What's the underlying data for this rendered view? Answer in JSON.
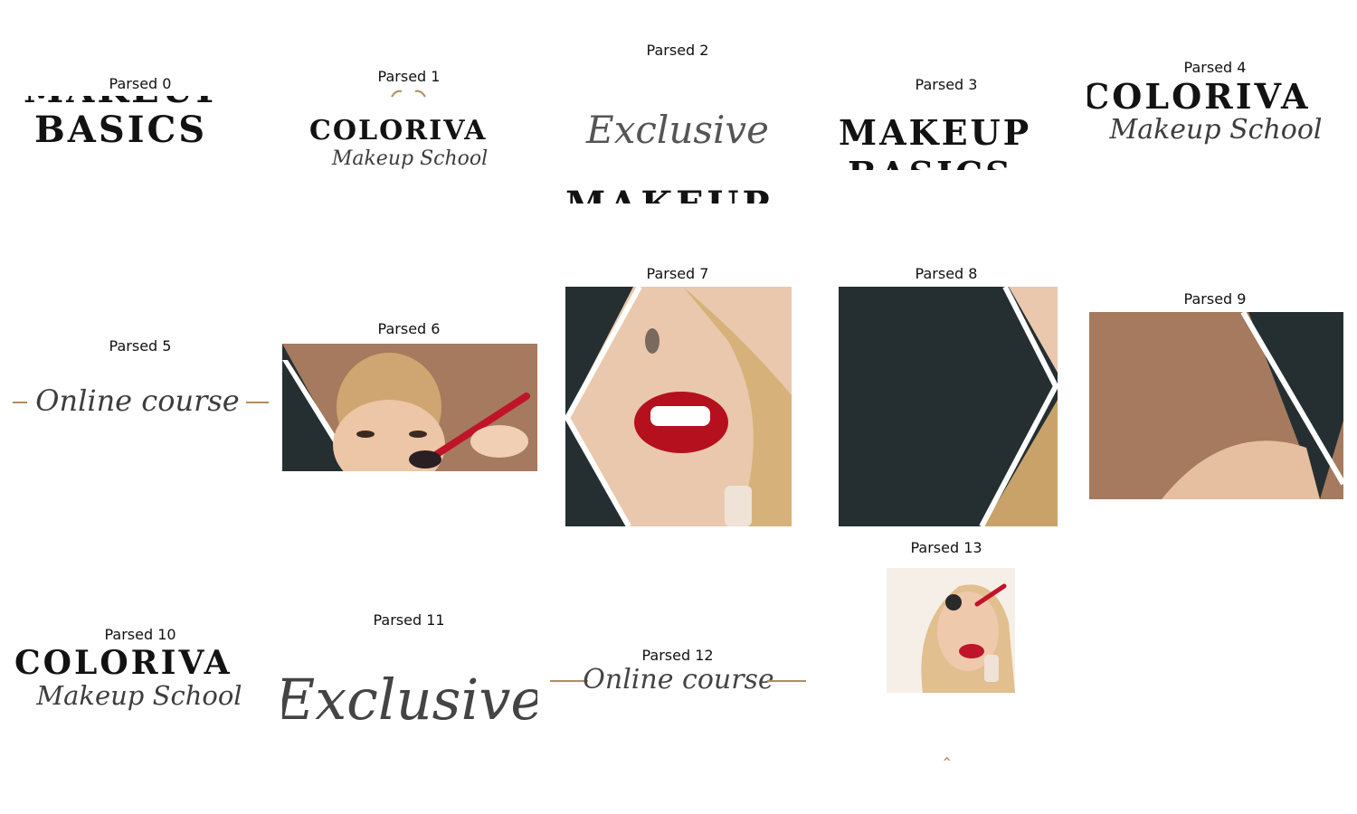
{
  "captions": [
    "Parsed 0",
    "Parsed 1",
    "Parsed 2",
    "Parsed 3",
    "Parsed 4",
    "Parsed 5",
    "Parsed 6",
    "Parsed 7",
    "Parsed 8",
    "Parsed 9",
    "Parsed 10",
    "Parsed 11",
    "Parsed 12",
    "Parsed 13"
  ],
  "texts": {
    "makeup": "MAKEUP",
    "basics": "BASICS",
    "brand": "COLORIVA",
    "school": "Makeup School",
    "exclusive": "Exclusive",
    "online_course": "Online course",
    "chevron": "⌃"
  },
  "colors": {
    "dark_teal": "#252f31",
    "skin_brown": "#a57a5e",
    "gold": "#b68a5a",
    "lip_red": "#c0142a"
  }
}
